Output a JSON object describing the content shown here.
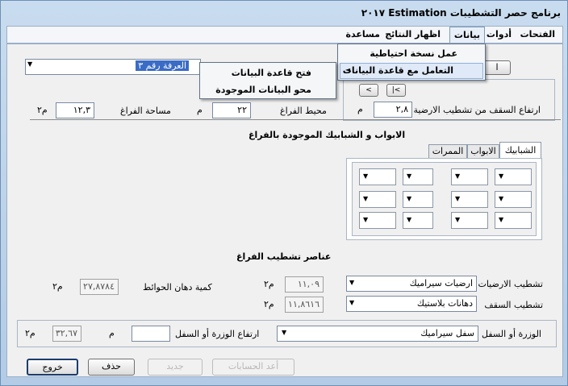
{
  "window": {
    "title": "برنامج حصر التشطيبات Estimation ٢٠١٧"
  },
  "menu": {
    "items": [
      "الفتحات",
      "أدوات",
      "بيانات",
      "اظهار النتائج",
      "مساعدة"
    ]
  },
  "data_menu": {
    "backup": "عمل نسخة احتياطية",
    "database": "التعامل مع قاعدة البيانات",
    "submenu_arrow": "◄"
  },
  "submenu": {
    "open_db": "فتح قاعدة البيانات",
    "clear_data": "محو البيانات الموجودة"
  },
  "room": {
    "selected_value": "العرفة رقم ٣",
    "partial_button": "ا"
  },
  "nav": {
    "first": "|<",
    "prev": "<",
    "partial_label": "ال"
  },
  "dimensions": {
    "ceiling_height_label": "ارتفاع السقف من تشطيب الارضية",
    "ceiling_height_value": "٢,٨",
    "ceiling_height_unit": "م",
    "perimeter_label": "محيط الفراغ",
    "perimeter_value": "٢٢",
    "perimeter_unit": "م",
    "area_label": "مساحة الفراغ",
    "area_value": "١٢,٣",
    "area_unit": "م٢"
  },
  "openings": {
    "section_title": "الابواب و الشبابيك الموجودة بالفراغ",
    "tabs": [
      "الشبابيك",
      "الابواب",
      "الممرات"
    ],
    "combo_arrow": "▼"
  },
  "finishes": {
    "section_title": "عناصر تشطيب الفراغ",
    "floor_label": "تشطيب الارضيات",
    "floor_value": "ارضيات سيراميك",
    "floor_qty": "١١,٠٩",
    "floor_unit": "م٢",
    "ceiling_label": "تشطيب السقف",
    "ceiling_value": "دهانات بلاستيك",
    "ceiling_qty": "١١,٨٦١٦",
    "ceiling_unit": "م٢",
    "wall_paint_label": "كمية دهان الحوائط",
    "wall_paint_qty": "٢٧,٨٧٨٤",
    "wall_paint_unit": "م٢"
  },
  "skirting": {
    "label": "الوزرة أو السفل",
    "value": "سفل سيراميك",
    "height_label": "ارتفاع الوزرة أو السفل",
    "height_value": "",
    "height_unit": "م",
    "qty": "٣٢,٦٧",
    "qty_unit": "م٢"
  },
  "buttons": {
    "exit": "خروج",
    "delete": "حذف",
    "disabled_1": "جديد",
    "disabled_2": "أعد الحسابات"
  }
}
